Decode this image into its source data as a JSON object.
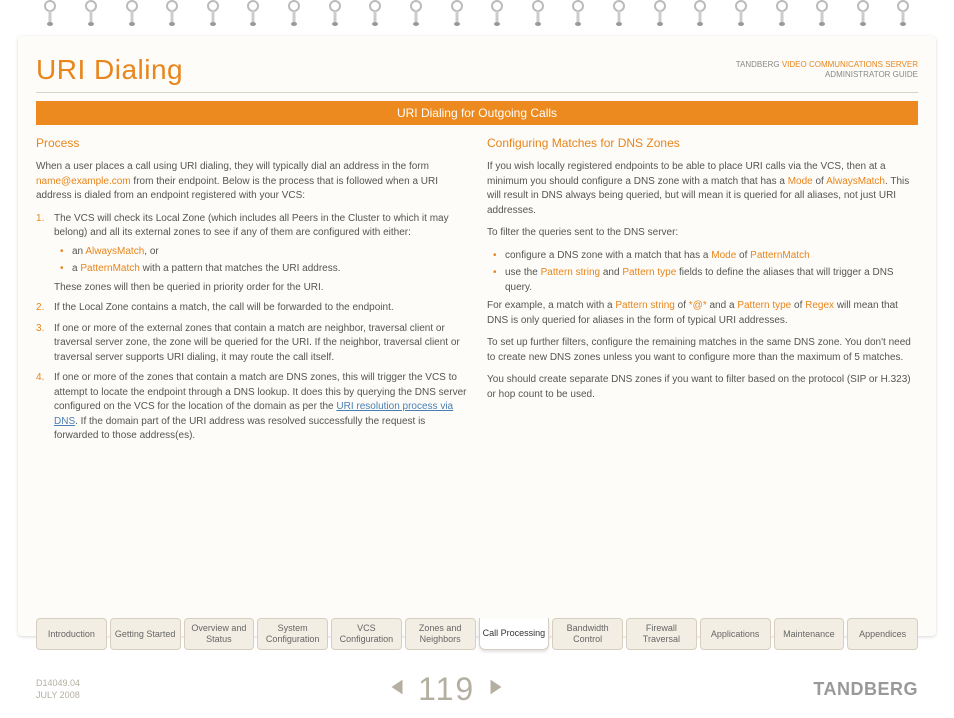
{
  "header": {
    "title": "URI Dialing",
    "brand": "TANDBERG",
    "product": "VIDEO COMMUNICATIONS SERVER",
    "subtitle": "ADMINISTRATOR GUIDE"
  },
  "banner": "URI Dialing for Outgoing Calls",
  "left": {
    "heading": "Process",
    "intro_a": "When a user places a call using URI dialing, they will typically dial an address in the form ",
    "intro_link": "name@example.com",
    "intro_b": " from their endpoint.  Below is the process that is followed when a URI address is dialed from an endpoint registered with your VCS:",
    "s1": "The VCS will check its Local Zone (which includes all Peers in the Cluster to which it may belong) and all its external zones to see if any of them are configured with either:",
    "s1a_a": "an ",
    "s1a_hl": "AlwaysMatch",
    "s1a_b": ", or",
    "s1b_a": "a ",
    "s1b_hl": "PatternMatch",
    "s1b_b": " with a pattern that matches the URI address.",
    "s1_tail": "These zones will then be queried in priority order for the URI.",
    "s2": "If the Local Zone contains a match, the call will be forwarded to the endpoint.",
    "s3": "If one or more of the external zones that contain a match are neighbor, traversal client or traversal server zone, the zone will be queried for the URI.  If the neighbor, traversal client or traversal server supports URI dialing, it may route the call itself.",
    "s4_a": "If one or more of the zones that contain a match are DNS zones, this will trigger the VCS to attempt to locate the endpoint through a DNS lookup.  It does this by querying the DNS server configured on the VCS for the location of the domain as per the ",
    "s4_link": "URI resolution process via DNS",
    "s4_b": ". If the domain part of the URI address was resolved successfully the request is forwarded to those address(es)."
  },
  "right": {
    "heading": "Configuring Matches for DNS Zones",
    "p1_a": "If you wish locally registered endpoints to be able to place URI calls via the VCS, then at a minimum you should configure a DNS zone with a match that has a ",
    "p1_hl1": "Mode",
    "p1_mid": " of ",
    "p1_hl2": "AlwaysMatch",
    "p1_b": ".  This will result in DNS always being queried, but will mean it is queried for all aliases, not just URI addresses.",
    "p2": "To filter the queries sent to the DNS server:",
    "b1_a": "configure a DNS zone with a match that has a ",
    "b1_hl1": "Mode",
    "b1_mid": " of ",
    "b1_hl2": "PatternMatch",
    "b2_a": "use the ",
    "b2_hl1": "Pattern string",
    "b2_mid": " and ",
    "b2_hl2": "Pattern type",
    "b2_b": " fields to define the aliases that will trigger a DNS query.",
    "p3_a": "For example, a match with a ",
    "p3_hl1": "Pattern string",
    "p3_mid1": " of ",
    "p3_code": "*@*",
    "p3_mid2": " and a ",
    "p3_hl2": "Pattern type",
    "p3_mid3": " of ",
    "p3_hl3": "Regex",
    "p3_b": " will mean that DNS is only queried for aliases in the form of typical URI addresses.",
    "p4": "To set up further filters, configure the remaining matches in the same DNS zone.  You don't need to create new DNS zones unless you want to configure more than the maximum of 5 matches.",
    "p5": "You should create separate DNS zones if you want to filter based on the protocol (SIP or H.323) or hop count to be used."
  },
  "tabs": [
    "Introduction",
    "Getting Started",
    "Overview and Status",
    "System Configuration",
    "VCS Configuration",
    "Zones and Neighbors",
    "Call Processing",
    "Bandwidth Control",
    "Firewall Traversal",
    "Applications",
    "Maintenance",
    "Appendices"
  ],
  "active_tab_index": 6,
  "footer": {
    "docnum": "D14049.04",
    "date": "JULY 2008",
    "page": "119",
    "brand": "TANDBERG"
  }
}
